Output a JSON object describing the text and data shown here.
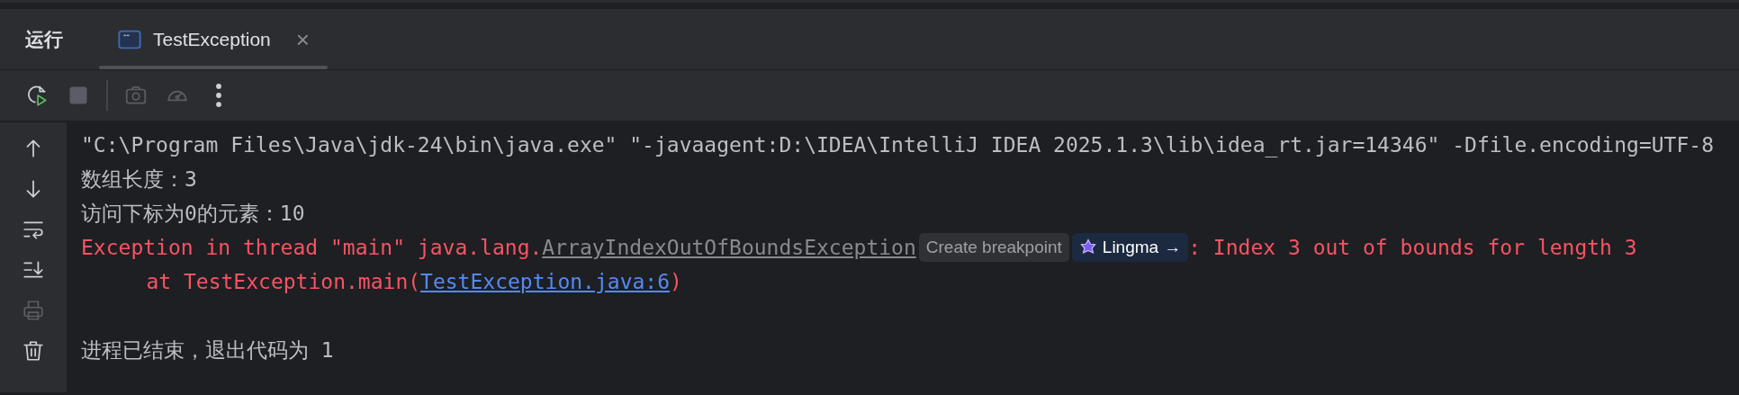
{
  "tool_window": {
    "title": "运行",
    "tabs": [
      {
        "label": "TestException",
        "selected": true,
        "close": "×"
      }
    ]
  },
  "toolbar": [
    {
      "kind": "rerun",
      "disabled": false
    },
    {
      "kind": "stop",
      "disabled": true
    },
    {
      "kind": "separator"
    },
    {
      "kind": "screenshot",
      "disabled": true
    },
    {
      "kind": "profiler",
      "disabled": true
    },
    {
      "kind": "more",
      "disabled": false
    }
  ],
  "sidebar": [
    {
      "kind": "up",
      "disabled": false
    },
    {
      "kind": "down",
      "disabled": false
    },
    {
      "kind": "wrap",
      "disabled": false
    },
    {
      "kind": "scroll_end",
      "disabled": false
    },
    {
      "kind": "print",
      "disabled": true
    },
    {
      "kind": "clear",
      "disabled": false
    }
  ],
  "console": [
    {
      "kind": "command",
      "parts": [
        {
          "kind": "text",
          "text": "\"C:\\Program Files\\Java\\jdk-24\\bin\\java.exe\" \"-javaagent:D:\\IDEA\\IntelliJ IDEA 2025.1.3\\lib\\idea_rt.jar=14346\" -Dfile.encoding=UTF-8"
        }
      ]
    },
    {
      "kind": "output",
      "parts": [
        {
          "kind": "text",
          "text": "数组长度：3"
        }
      ]
    },
    {
      "kind": "output",
      "parts": [
        {
          "kind": "text",
          "text": "访问下标为0的元素：10"
        }
      ]
    },
    {
      "kind": "error",
      "parts": [
        {
          "kind": "text",
          "text": "Exception in thread \"main\" java.lang."
        },
        {
          "kind": "class_link",
          "text": "ArrayIndexOutOfBoundsException"
        },
        {
          "kind": "hint",
          "text": "Create breakpoint"
        },
        {
          "kind": "ai_chip",
          "text": "Lingma",
          "arrow": "→"
        },
        {
          "kind": "text",
          "text": ": Index 3 out of bounds for length 3"
        }
      ]
    },
    {
      "kind": "error",
      "indent": true,
      "parts": [
        {
          "kind": "text",
          "text": "at TestException.main("
        },
        {
          "kind": "file_link",
          "text": "TestException.java:6"
        },
        {
          "kind": "text",
          "text": ")"
        }
      ]
    },
    {
      "kind": "blank"
    },
    {
      "kind": "output",
      "parts": [
        {
          "kind": "text",
          "text": "进程已结束，退出代码为 1"
        }
      ]
    }
  ]
}
